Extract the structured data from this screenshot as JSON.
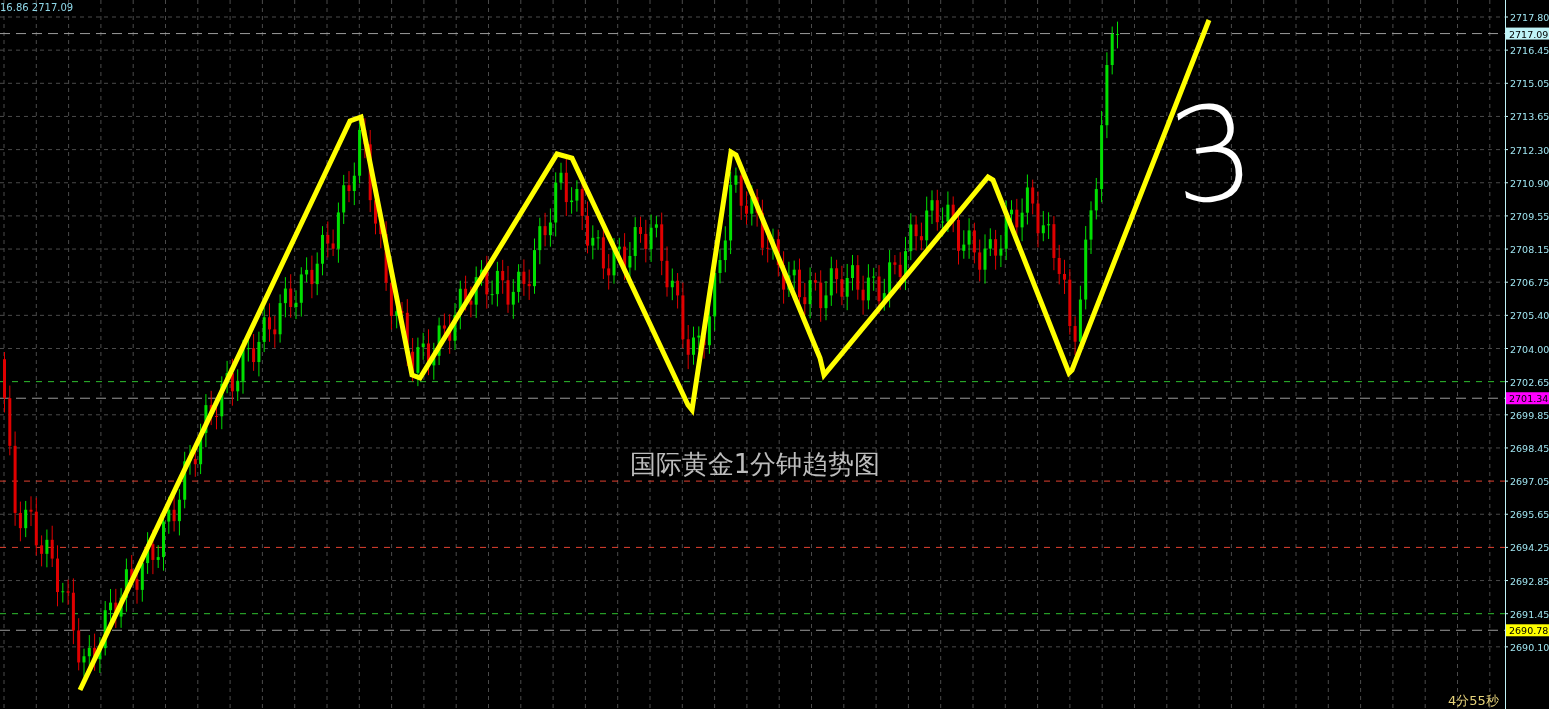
{
  "header_text": "16.86 2717.09",
  "title": "国际黄金1分钟趋势图",
  "handwritten_label": "3",
  "countdown": "4分55秒",
  "price_axis": [
    {
      "kind": "tick",
      "text": "2717.80"
    },
    {
      "kind": "marker",
      "text": "2717.09",
      "color": "#bff3f7"
    },
    {
      "kind": "tick",
      "text": "2716.45"
    },
    {
      "kind": "tick",
      "text": "2715.05"
    },
    {
      "kind": "tick",
      "text": "2713.65"
    },
    {
      "kind": "tick",
      "text": "2712.30"
    },
    {
      "kind": "tick",
      "text": "2710.90"
    },
    {
      "kind": "tick",
      "text": "2709.55"
    },
    {
      "kind": "tick",
      "text": "2708.15"
    },
    {
      "kind": "tick",
      "text": "2706.75"
    },
    {
      "kind": "tick",
      "text": "2705.40"
    },
    {
      "kind": "tick",
      "text": "2704.00"
    },
    {
      "kind": "tick",
      "text": "2702.65"
    },
    {
      "kind": "marker",
      "text": "2701.34",
      "color": "#ff00ff"
    },
    {
      "kind": "tick",
      "text": "2699.85"
    },
    {
      "kind": "tick",
      "text": "2698.45"
    },
    {
      "kind": "tick",
      "text": "2697.05"
    },
    {
      "kind": "tick",
      "text": "2695.65"
    },
    {
      "kind": "tick",
      "text": "2694.25"
    },
    {
      "kind": "tick",
      "text": "2692.85"
    },
    {
      "kind": "tick",
      "text": "2691.45"
    },
    {
      "kind": "marker",
      "text": "2690.78",
      "color": "#ffff00"
    },
    {
      "kind": "tick",
      "text": "2690.10"
    }
  ]
}
